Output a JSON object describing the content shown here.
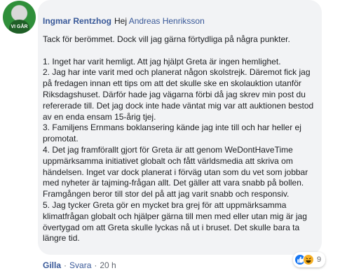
{
  "comment": {
    "avatar_text": "VI GÅR",
    "author": "Ingmar Rentzhog",
    "greeting": "Hej",
    "mention": "Andreas Henriksson",
    "body": "Tack för berömmet. Dock vill jag gärna förtydliga på några punkter.\n\n1. Inget har varit hemligt. Att jag hjälpt Greta är ingen hemlighet.\n2. Jag har inte varit med och planerat någon skolstrejk. Däremot fick jag på fredagen innan ett tips om att det skulle ske en skolauktion utanför Riksdagshuset. Därför hade jag vägarna förbi då jag skrev min post du refererade till. Det jag dock inte hade väntat mig var att auktionen bestod av en enda ensam 15-årig tjej.\n3. Familjens Ernmans boklansering kände jag inte till och har heller ej promotat.\n4. Det jag framförallt gjort för Greta är att genom WeDontHaveTime uppmärksamma initiativet globalt och fått världsmedia att skriva om händelsen. Inget var dock planerat i förväg utan som du vet som jobbar med nyheter är tajming-frågan allt. Det gäller att vara snabb på bollen. Framgången beror till stor del på att jag varit snabb och responsiv.\n5. Jag tycker Greta gör en mycket bra grej för att uppmärksamma klimatfrågan globalt och hjälper gärna till men med eller utan mig är jag övertygad om att Greta skulle lyckas nå ut i bruset. Det skulle bara ta längre tid."
  },
  "actions": {
    "like": "Gilla",
    "separator": "·",
    "reply": "Svara",
    "time": "20 h"
  },
  "reactions": {
    "icons": [
      "like-icon",
      "haha-icon"
    ],
    "count": "9"
  },
  "colors": {
    "link": "#385898",
    "bubble": "#f2f3f5",
    "like_blue": "#1877f2",
    "haha_yellow": "#f7b125"
  }
}
